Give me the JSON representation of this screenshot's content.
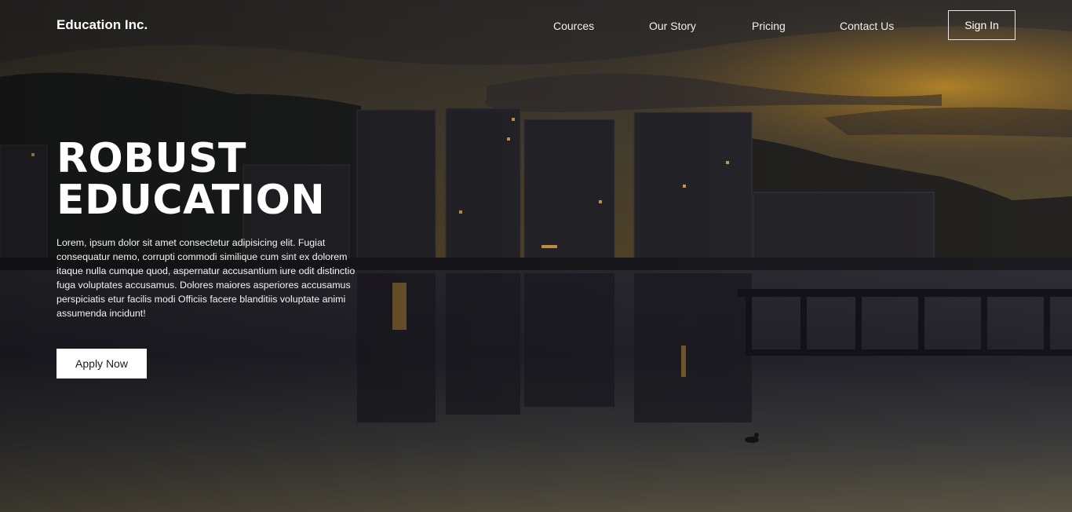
{
  "nav": {
    "brand": "Education Inc.",
    "links": [
      "Cources",
      "Our Story",
      "Pricing",
      "Contact Us"
    ],
    "signin_label": "Sign In"
  },
  "hero": {
    "headline_line1": "ROBUST",
    "headline_line2": "EDUCATION",
    "body": "Lorem, ipsum dolor sit amet consectetur adipisicing elit. Fugiat consequatur nemo, corrupti commodi similique cum sint ex dolorem itaque nulla cumque quod, aspernatur accusantium iure odit distinctio fuga voluptates accusamus. Dolores maiores asperiores accusamus perspiciatis etur facilis modi Officiis facere blanditiis voluptate animi assumenda incidunt!",
    "cta_label": "Apply Now"
  },
  "colors": {
    "text": "#ffffff",
    "button_bg": "#ffffff",
    "button_text": "#1a1a1a",
    "sky_glow": "#d9a128"
  }
}
